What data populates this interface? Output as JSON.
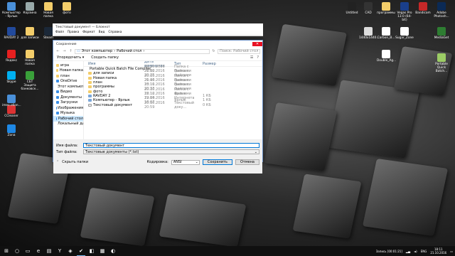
{
  "desktop": {
    "icons_left": [
      {
        "label": "Компьютер - Ярлык",
        "color": "#4a90d9"
      },
      {
        "label": "Корзина",
        "color": "#9aa"
      },
      {
        "label": "Новая папка",
        "color": "#f3cd6a"
      },
      {
        "label": "фото",
        "color": "#f3cd6a"
      },
      {
        "label": "RAVDAY 2",
        "color": "#224a9c"
      },
      {
        "label": "для записи",
        "color": "#f3cd6a"
      },
      {
        "label": "Яндекс",
        "color": "#e62020"
      },
      {
        "label": "Steam",
        "color": "#1b2838"
      },
      {
        "label": "Skype",
        "color": "#00aff0"
      },
      {
        "label": "Новая папка",
        "color": "#f3cd6a"
      },
      {
        "label": "CCleaner",
        "color": "#d33"
      },
      {
        "label": "СБТ Защита банковск...",
        "color": "#3aa03a"
      },
      {
        "label": "imeo.обоn...",
        "color": "#4a90d9"
      },
      {
        "label": "Zona",
        "color": "#1e88e5"
      }
    ],
    "icons_right": [
      {
        "label": "Untitled",
        "color": "#222"
      },
      {
        "label": "CAD",
        "color": "#333"
      },
      {
        "label": "программы",
        "color": "#f3cd6a"
      },
      {
        "label": "Vegas Pro 13.0 (64-bit)",
        "color": "#1a3f8c"
      },
      {
        "label": "Bandicam",
        "color": "#c62828"
      },
      {
        "label": "Adobe Photosh...",
        "color": "#0b2a55"
      },
      {
        "label": "1440x1440...",
        "color": "#ddd"
      },
      {
        "label": "Carbon_B...",
        "color": "#fff"
      },
      {
        "label": "Sugar_Zone",
        "color": "#fff"
      },
      {
        "label": "MediaGet",
        "color": "#2e7d32"
      },
      {
        "label": "Double_Ag...",
        "color": "#fff"
      },
      {
        "label": "Portable Quick Batch...",
        "color": "#9ccc65"
      }
    ]
  },
  "notepad": {
    "title": "Текстовый документ — Блокнот",
    "menu": [
      "Файл",
      "Правка",
      "Формат",
      "Вид",
      "Справка"
    ]
  },
  "dialog": {
    "title": "Сохранение",
    "close": "✕",
    "path": [
      "Этот компьютер",
      "Рабочий стол"
    ],
    "search_placeholder": "Поиск: Рабочий стол",
    "organize": "Упорядочить ▾",
    "new_folder": "Создать папку",
    "sidebar": [
      {
        "label": "игра",
        "type": "folder"
      },
      {
        "label": "Новая папка",
        "type": "folder"
      },
      {
        "label": "план",
        "type": "folder"
      },
      {
        "label": "OneDrive",
        "type": "cloud"
      },
      {
        "label": "Этот компьютер",
        "type": "pc"
      },
      {
        "label": "Видео",
        "type": "video"
      },
      {
        "label": "Документы",
        "type": "doc"
      },
      {
        "label": "Загрузки",
        "type": "down"
      },
      {
        "label": "Изображения",
        "type": "img"
      },
      {
        "label": "Музыка",
        "type": "music"
      },
      {
        "label": "Рабочий стол",
        "type": "desk",
        "selected": true
      },
      {
        "label": "Локальный диск",
        "type": "disk"
      }
    ],
    "columns": {
      "name": "Имя",
      "date": "Дата изменения",
      "type": "Тип",
      "size": "Размер"
    },
    "files": [
      {
        "name": "Portable Quick Batch File Compiler",
        "date": "20.10.2016 21:02",
        "type": "Папка с файлами",
        "size": "",
        "kind": "folder"
      },
      {
        "name": "для записи",
        "date": "20.10.2016 20:25",
        "type": "Папка с файлами",
        "size": "",
        "kind": "folder"
      },
      {
        "name": "Новая папка",
        "date": "20.10.2016 20:46",
        "type": "Папка с файлами",
        "size": "",
        "kind": "folder"
      },
      {
        "name": "план",
        "date": "21.10.2016 18:11",
        "type": "Папка с файлами",
        "size": "",
        "kind": "folder"
      },
      {
        "name": "программы",
        "date": "20.10.2016 20:33",
        "type": "Папка с файлами",
        "size": "",
        "kind": "folder"
      },
      {
        "name": "фото",
        "date": "20.10.2016 22:12",
        "type": "Папка с файлами",
        "size": "",
        "kind": "folder"
      },
      {
        "name": "RAVDAY 2",
        "date": "18.10.2016 22:04",
        "type": "Ярлык Интернета",
        "size": "1 КБ",
        "kind": "link"
      },
      {
        "name": "Компьютер - Ярлык",
        "date": "19.10.2016 18:07",
        "type": "Ярлык",
        "size": "1 КБ",
        "kind": "link"
      },
      {
        "name": "Текстовый документ",
        "date": "20.10.2016 20:59",
        "type": "Текстовый доку...",
        "size": "0 КБ",
        "kind": "file"
      }
    ],
    "filename_label": "Имя файла:",
    "filename_value": "Текстовый документ",
    "filetype_label": "Тип файла:",
    "filetype_value": "Текстовые документы (*.txt)",
    "hide_folders": "Скрыть папки",
    "encoding_label": "Кодировка:",
    "encoding_value": "ANSI",
    "save": "Сохранить",
    "cancel": "Отмена"
  },
  "taskbar": {
    "items": [
      "⊞",
      "○",
      "▭",
      "e",
      "▤",
      "Y",
      "◈",
      "✔",
      "◧",
      "▦",
      "◐"
    ],
    "tray": {
      "rec": "Запись [00:01:21]",
      "lang": "ENG",
      "time": "18:11",
      "date": "21.10.2016"
    }
  }
}
